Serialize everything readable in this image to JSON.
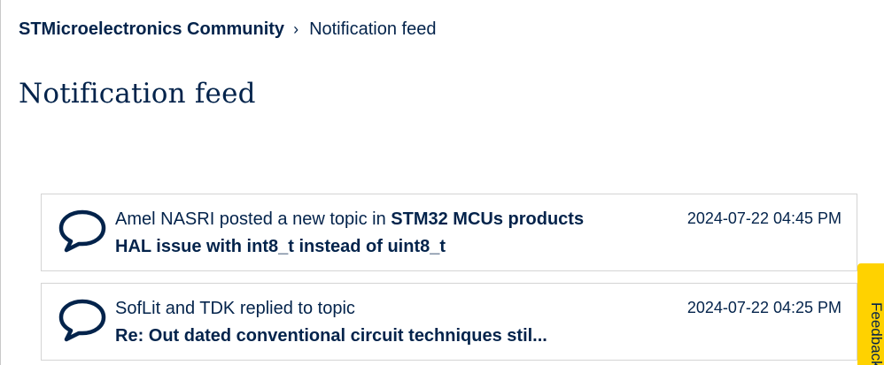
{
  "breadcrumb": {
    "home_label": "STMicroelectronics Community",
    "separator": "›",
    "current_label": "Notification feed"
  },
  "page": {
    "title": "Notification feed"
  },
  "feed": [
    {
      "actor_text": "Amel NASRI posted a new topic in",
      "board": "STM32 MCUs products",
      "subject": "HAL issue with int8_t instead of uint8_t",
      "timestamp": "2024-07-22 04:45 PM",
      "icon": "speech-bubble-icon"
    },
    {
      "actor_text": "SofLit and TDK replied to topic",
      "board": "",
      "subject": "Re: Out dated conventional circuit techniques stil...",
      "timestamp": "2024-07-22 04:25 PM",
      "icon": "speech-bubble-icon"
    }
  ],
  "feedback": {
    "label": "Feedback"
  },
  "colors": {
    "text": "#03234b",
    "accent": "#ffd200",
    "border": "#d4d4d4"
  }
}
